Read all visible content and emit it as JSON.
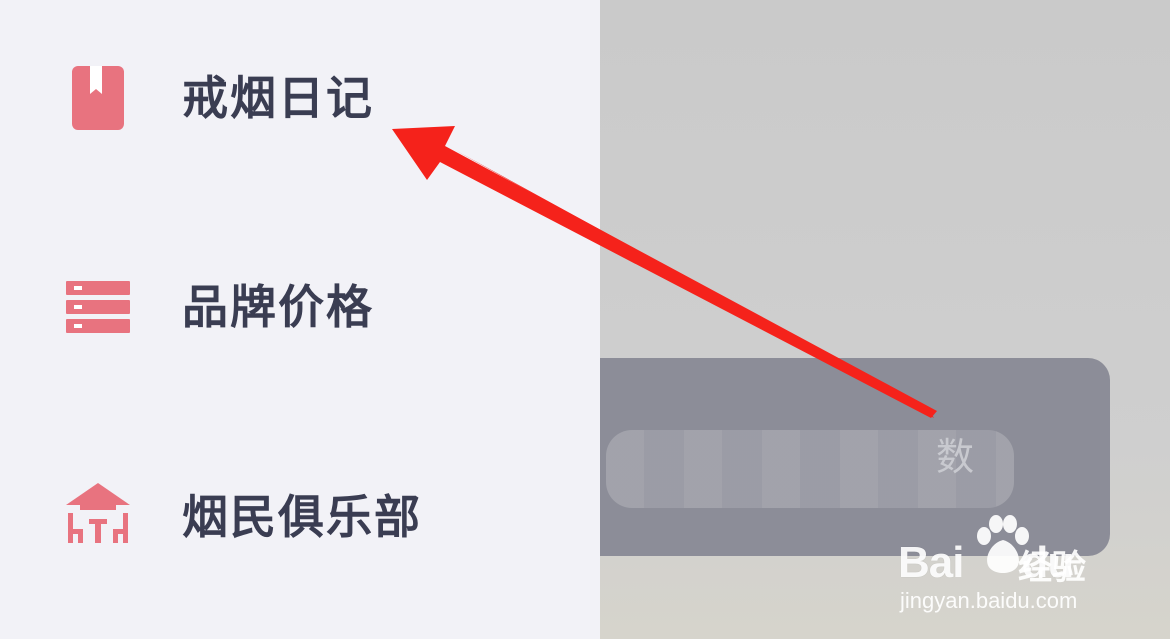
{
  "menu": {
    "items": [
      {
        "label": "戒烟日记",
        "icon": "diary-book-icon"
      },
      {
        "label": "品牌价格",
        "icon": "list-icon"
      },
      {
        "label": "烟民俱乐部",
        "icon": "club-house-icon"
      }
    ]
  },
  "toast": {
    "visible_text": "数"
  },
  "watermark": {
    "brand": "Bai",
    "brand_suffix": "du",
    "product": "经验",
    "url": "jingyan.baidu.com"
  },
  "colors": {
    "icon_accent": "#e8737f",
    "menu_text": "#3a3d52",
    "drawer_bg": "#f2f2f7",
    "annotation_arrow": "#f5221b"
  }
}
